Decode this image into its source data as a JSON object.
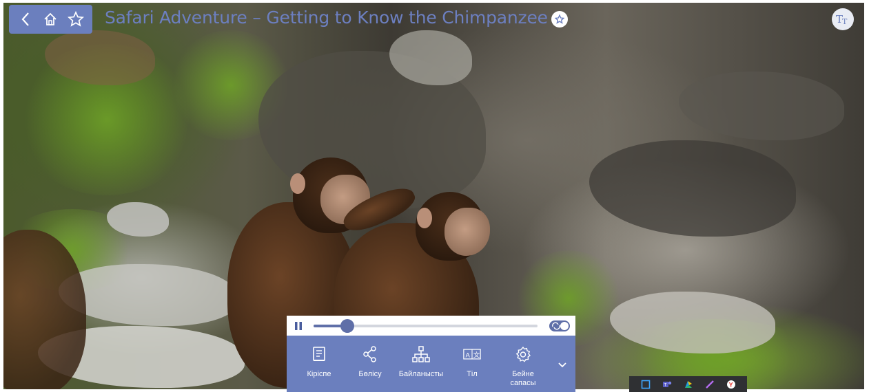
{
  "title": "Safari Adventure – Getting to Know the Chimpanzee",
  "nav": {
    "back_icon": "chevron-left-icon",
    "home_icon": "home-icon",
    "favorite_icon": "star-icon"
  },
  "title_badge_icon": "star-badge-icon",
  "text_size_icon": "text-size-icon",
  "player": {
    "progress": 0.15,
    "paused_state_icon": "pause-icon",
    "loop_enabled": true
  },
  "toolbar": [
    {
      "id": "intro",
      "label": "Кіріспе",
      "icon": "document-icon"
    },
    {
      "id": "share",
      "label": "Бөлісу",
      "icon": "share-icon"
    },
    {
      "id": "related",
      "label": "Байланысты",
      "icon": "hierarchy-icon"
    },
    {
      "id": "language",
      "label": "Тіл",
      "icon": "translate-icon"
    },
    {
      "id": "quality",
      "label": "Бейне\nсапасы",
      "icon": "gear-icon"
    }
  ],
  "taskbar": [
    "snip-icon",
    "teams-icon",
    "store-icon",
    "pen-icon",
    "yandex-icon"
  ],
  "colors": {
    "accent": "#6b7fbe",
    "accent_dark": "#5f6fa8",
    "title": "#6c7fc0",
    "taskbar": "#2f3033"
  }
}
